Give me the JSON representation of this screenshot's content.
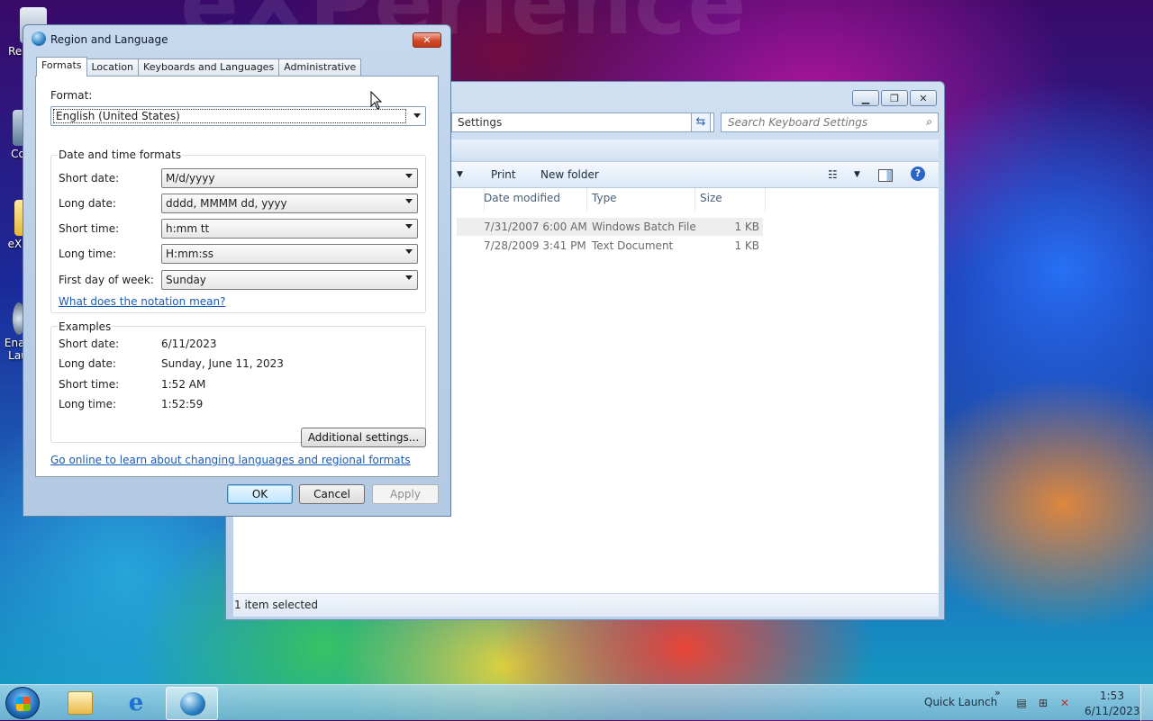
{
  "desktop": {
    "watermark": "eXPerience",
    "icons": [
      {
        "label": "Rec",
        "icon": "recycle-bin-icon"
      },
      {
        "label": "Co",
        "icon": "computer-icon"
      },
      {
        "label": "eXP",
        "icon": "folder-icon"
      },
      {
        "label": "Enab",
        "label2": "Lau",
        "icon": "launcher-icon"
      }
    ]
  },
  "explorer": {
    "address": "Settings",
    "search_placeholder": "Search Keyboard Settings",
    "commands": {
      "print": "Print",
      "new_folder": "New folder"
    },
    "columns": {
      "date_modified": "Date modified",
      "type": "Type",
      "size": "Size"
    },
    "rows": [
      {
        "date": "7/31/2007 6:00 AM",
        "type": "Windows Batch File",
        "size": "1 KB"
      },
      {
        "date": "7/28/2009 3:41 PM",
        "type": "Text Document",
        "size": "1 KB"
      }
    ],
    "status": "1 item selected"
  },
  "dialog": {
    "title": "Region and Language",
    "close": "✕",
    "tabs": [
      "Formats",
      "Location",
      "Keyboards and Languages",
      "Administrative"
    ],
    "format_label": "Format:",
    "format_value": "English (United States)",
    "datetime_group": "Date and time formats",
    "fields": {
      "short_date": {
        "label": "Short date:",
        "value": "M/d/yyyy"
      },
      "long_date": {
        "label": "Long date:",
        "value": "dddd, MMMM dd, yyyy"
      },
      "short_time": {
        "label": "Short time:",
        "value": "h:mm tt"
      },
      "long_time": {
        "label": "Long time:",
        "value": "H:mm:ss"
      },
      "first_day": {
        "label": "First day of week:",
        "value": "Sunday"
      }
    },
    "notation_link": "What does the notation mean?",
    "examples_group": "Examples",
    "examples": {
      "short_date": {
        "label": "Short date:",
        "value": "6/11/2023"
      },
      "long_date": {
        "label": "Long date:",
        "value": "Sunday, June 11, 2023"
      },
      "short_time": {
        "label": "Short time:",
        "value": "1:52 AM"
      },
      "long_time": {
        "label": "Long time:",
        "value": "1:52:59"
      }
    },
    "additional_settings": "Additional settings...",
    "online_link": "Go online to learn about changing languages and regional formats",
    "ok": "OK",
    "cancel": "Cancel",
    "apply": "Apply"
  },
  "taskbar": {
    "quick_launch": "Quick Launch",
    "chevron": "»",
    "time": "1:53",
    "date": "6/11/2023",
    "pinned": [
      "explorer-icon",
      "internet-explorer-icon",
      "region-globe-icon"
    ]
  }
}
